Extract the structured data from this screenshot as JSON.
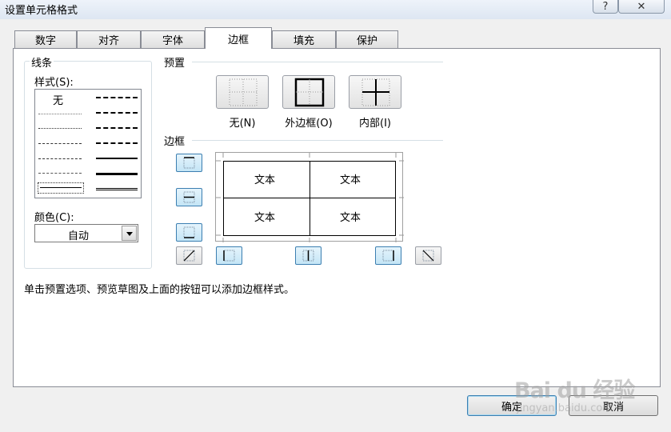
{
  "window": {
    "title": "设置单元格格式",
    "help_glyph": "?",
    "close_glyph": "✕"
  },
  "tabs": [
    {
      "label": "数字",
      "active": false
    },
    {
      "label": "对齐",
      "active": false
    },
    {
      "label": "字体",
      "active": false
    },
    {
      "label": "边框",
      "active": true
    },
    {
      "label": "填充",
      "active": false
    },
    {
      "label": "保护",
      "active": false
    }
  ],
  "line_group": {
    "title": "线条",
    "style_label": "样式(S):",
    "style_none": "无",
    "color_label": "颜色(C):",
    "color_value": "自动"
  },
  "presets": {
    "title": "预置",
    "items": [
      {
        "label": "无(N)"
      },
      {
        "label": "外边框(O)"
      },
      {
        "label": "内部(I)"
      }
    ]
  },
  "border_group": {
    "title": "边框"
  },
  "preview_cells": [
    "文本",
    "文本",
    "文本",
    "文本"
  ],
  "hint": "单击预置选项、预览草图及上面的按钮可以添加边框样式。",
  "buttons": {
    "ok": "确定",
    "cancel": "取消"
  },
  "watermark": {
    "logo": "Bai du 经验",
    "url": "jingyan.baidu.com"
  },
  "colors": {
    "accent": "#3c7fb1",
    "border": "#898c95",
    "selected_button": "#c4e5f6"
  }
}
